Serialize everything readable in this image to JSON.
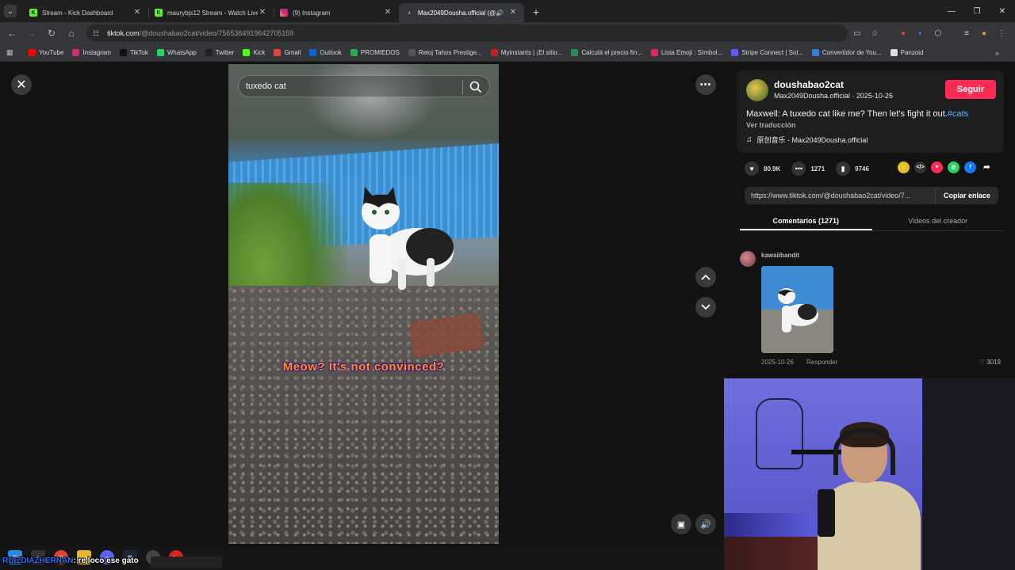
{
  "browser": {
    "tabs": [
      {
        "title": "Stream - Kick Dashboard",
        "icon": "kick-icon",
        "active": false
      },
      {
        "title": "maurybjs12 Stream - Watch Live",
        "icon": "kick-icon",
        "active": false
      },
      {
        "title": "(9) Instagram",
        "icon": "instagram-icon",
        "active": false
      },
      {
        "title": "Max2049Dousha.official (@",
        "icon": "tiktok-icon",
        "active": true
      }
    ],
    "url_host": "tiktok.com",
    "url_path": "/@doushabao2cat/video/7565364919642705159",
    "bookmarks": [
      {
        "label": "YouTube",
        "color": "#ff0000"
      },
      {
        "label": "Instagram",
        "color": "#d62976"
      },
      {
        "label": "TikTok",
        "color": "#111111"
      },
      {
        "label": "WhatsApp",
        "color": "#25d366"
      },
      {
        "label": "Twitter",
        "color": "#222222"
      },
      {
        "label": "Kick",
        "color": "#53fc18"
      },
      {
        "label": "Gmail",
        "color": "#ea4335"
      },
      {
        "label": "Outlook",
        "color": "#0a64d8"
      },
      {
        "label": "PROMIEDOS",
        "color": "#2fa84f"
      },
      {
        "label": "Reloj Tahos Prestige...",
        "color": "#555555"
      },
      {
        "label": "Myinstants | ¡El sitio...",
        "color": "#c81e1e"
      },
      {
        "label": "Calculá el precio fin...",
        "color": "#2e8b57"
      },
      {
        "label": "Lista Emoji : Símbol...",
        "color": "#e0245e"
      },
      {
        "label": "Stripe Connect | Sol...",
        "color": "#635bff"
      },
      {
        "label": "Convertidor de You...",
        "color": "#3a7bd5"
      },
      {
        "label": "Panzoid",
        "color": "#dddddd"
      }
    ]
  },
  "video": {
    "search_text": "tuxedo cat",
    "caption": "Meow? It's not convinced?"
  },
  "post": {
    "username": "doushabao2cat",
    "display_name": "Max2049Dousha.official",
    "date": "2025-10-26",
    "follow_label": "Seguir",
    "description": "Maxwell: A tuxedo cat like me? Then let's fight it out.",
    "hashtag": "#cats",
    "translate_label": "Ver traducción",
    "music": "原创音乐 - Max2049Dousha.official",
    "likes": "80.9K",
    "comments": "1271",
    "saves": "9746",
    "share_url": "https://www.tiktok.com/@doushabao2cat/video/7...",
    "copy_label": "Copiar enlace",
    "tab_comments": "Comentarios (1271)",
    "tab_creator": "Videos del creador"
  },
  "comment": {
    "user": "kawaiibandit",
    "date": "2025-10-26",
    "reply_label": "Responder",
    "likes": "3019"
  },
  "chat": {
    "user": "RUIZDIAZHERNAN",
    "message": ": re loco ese gato"
  }
}
